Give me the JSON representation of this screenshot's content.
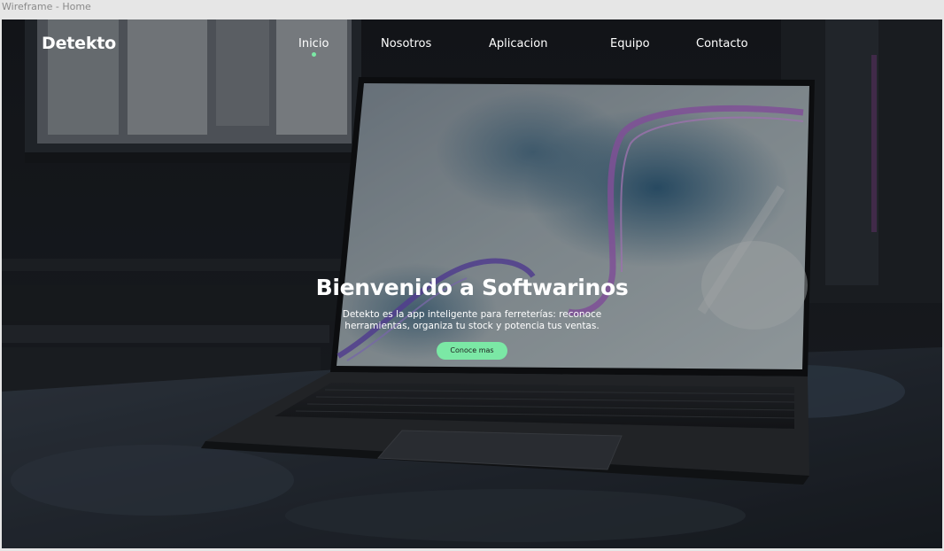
{
  "window": {
    "title": "Wireframe - Home"
  },
  "nav": {
    "logo": "Detekto",
    "items": [
      {
        "label": "Inicio",
        "active": true
      },
      {
        "label": "Nosotros",
        "active": false
      },
      {
        "label": "Aplicacion",
        "active": false
      },
      {
        "label": "Equipo",
        "active": false
      },
      {
        "label": "Contacto",
        "active": false
      }
    ]
  },
  "hero": {
    "title": "Bienvenido a Softwarinos",
    "description": "Detekto es la app inteligente para ferreterías: reconoce herramientas, organiza tu stock y potencia tus ventas.",
    "cta_label": "Conoce mas"
  },
  "colors": {
    "accent": "#7be8a5",
    "text": "#ffffff",
    "frame_bg": "#e6e6e6"
  }
}
